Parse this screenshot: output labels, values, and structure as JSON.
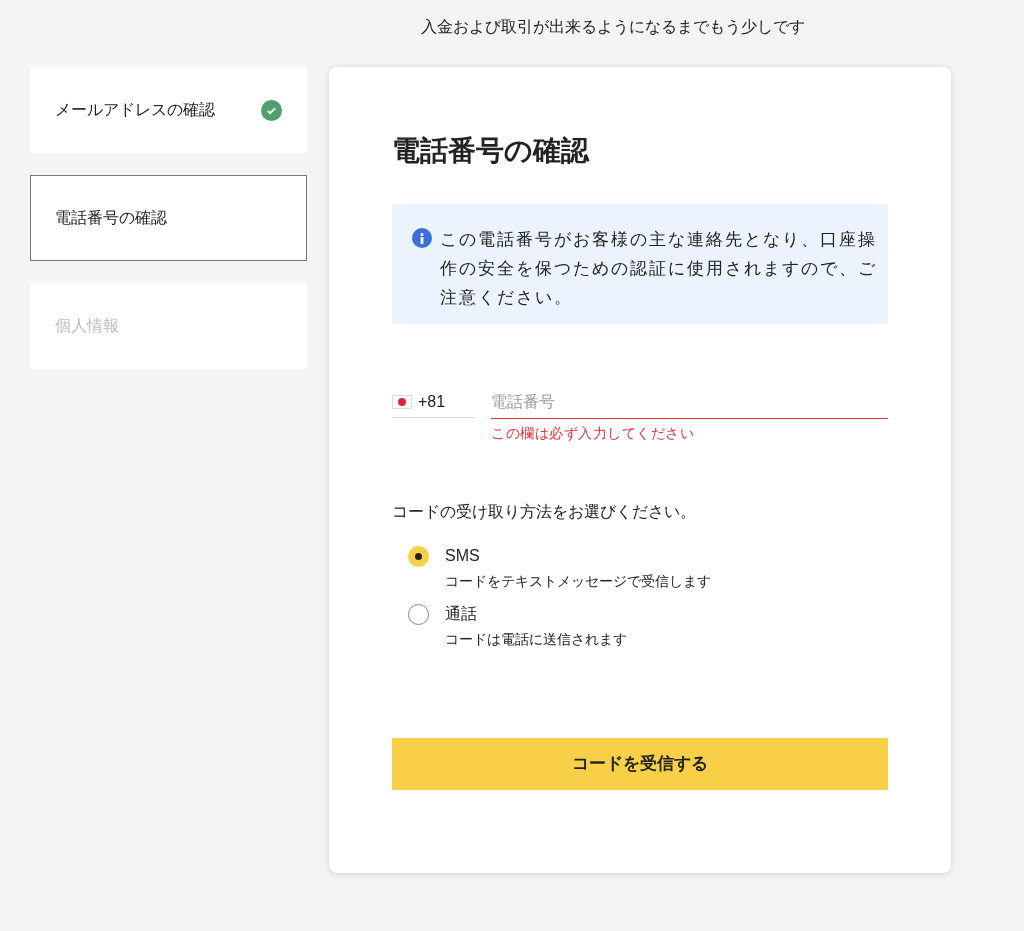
{
  "header": {
    "text": "入金および取引が出来るようになるまでもう少しです"
  },
  "steps": [
    {
      "label": "メールアドレスの確認",
      "completed": true,
      "selected": false,
      "disabled": false
    },
    {
      "label": "電話番号の確認",
      "completed": false,
      "selected": true,
      "disabled": false
    },
    {
      "label": "個人情報",
      "completed": false,
      "selected": false,
      "disabled": true
    }
  ],
  "card": {
    "title": "電話番号の確認",
    "info": "この電話番号がお客様の主な連絡先となり、口座操作の安全を保つための認証に使用されますので、ご注意ください。",
    "phone": {
      "country_code": "+81",
      "placeholder": "電話番号",
      "error": "この欄は必ず入力してください"
    },
    "method_prompt": "コードの受け取り方法をお選びください。",
    "methods": [
      {
        "label": "SMS",
        "description": "コードをテキストメッセージで受信します",
        "selected": true
      },
      {
        "label": "通話",
        "description": "コードは電話に送信されます",
        "selected": false
      }
    ],
    "submit": "コードを受信する"
  }
}
